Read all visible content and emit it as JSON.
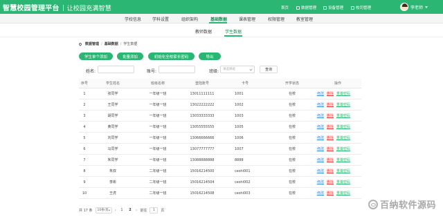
{
  "header": {
    "title": "智慧校园管理平台",
    "slogan": "让校园充满智慧",
    "nav": [
      "首页",
      "数据管理",
      "设备管理",
      "校司管理"
    ],
    "user_name": "李老师"
  },
  "menu": {
    "items": [
      "学校信息",
      "学科设置",
      "组织架构",
      "基础数据",
      "课表管理",
      "权限管理",
      "教室管理"
    ],
    "active": "基础数据"
  },
  "subtabs": {
    "items": [
      "教师数据",
      "学生数据"
    ],
    "active": "学生数据"
  },
  "breadcrumb": [
    "数据管理",
    "基础数据",
    "学生数据"
  ],
  "actions": [
    "学生单个添加",
    "批量添加",
    "初始化全校家长密码",
    "导出"
  ],
  "filters": {
    "name_label": "姓名:",
    "account_label": "账号:",
    "class_label": "班级:",
    "class_placeholder": "请选择班",
    "query_label": "查询"
  },
  "table": {
    "headers": [
      "序号",
      "学生姓名",
      "班级名称",
      "登陆账号",
      "卡号",
      "开学状态",
      "操作"
    ],
    "ops": {
      "edit": "修改",
      "delete": "删除",
      "reset": "重置密码"
    },
    "rows": [
      {
        "no": "1",
        "name": "张同学",
        "class": "一年级一班",
        "account": "13011111111",
        "card": "1001",
        "status": "在校"
      },
      {
        "no": "2",
        "name": "王同学",
        "class": "一年级一班",
        "account": "13022222222",
        "card": "1002",
        "status": "在校"
      },
      {
        "no": "3",
        "name": "胡同学",
        "class": "一年级一班",
        "account": "13033333333",
        "card": "1003",
        "status": "在校"
      },
      {
        "no": "4",
        "name": "黄同学",
        "class": "一年级一班",
        "account": "13055555555",
        "card": "1005",
        "status": "在校"
      },
      {
        "no": "5",
        "name": "刘同学",
        "class": "一年级一班",
        "account": "13066666666",
        "card": "1006",
        "status": "在校"
      },
      {
        "no": "6",
        "name": "马同学",
        "class": "一年级一班",
        "account": "13077777777",
        "card": "1007",
        "status": "在校"
      },
      {
        "no": "7",
        "name": "朱同学",
        "class": "一年级一班",
        "account": "13088888888",
        "card": "8888",
        "status": "在校"
      },
      {
        "no": "8",
        "name": "朱双",
        "class": "二年级一班",
        "account": "15016214500",
        "card": "ceshi001",
        "status": "在校"
      },
      {
        "no": "9",
        "name": "李彬",
        "class": "二年级一班",
        "account": "15016214504",
        "card": "ceshi002",
        "status": "在校"
      },
      {
        "no": "10",
        "name": "王虎",
        "class": "二年级一班",
        "account": "15016214508",
        "card": "ceshi003",
        "status": "在校"
      }
    ]
  },
  "pagination": {
    "total_text": "共 17 条",
    "page_size": "10条/页",
    "pages": [
      "1",
      "2"
    ],
    "current": "2",
    "goto_label": "前往",
    "goto_value": "1",
    "page_suffix": "页"
  },
  "watermark": "百纳软件源码",
  "colors": {
    "primary": "#2bb673",
    "edit": "#2d8cf0",
    "delete": "#ee3333"
  }
}
